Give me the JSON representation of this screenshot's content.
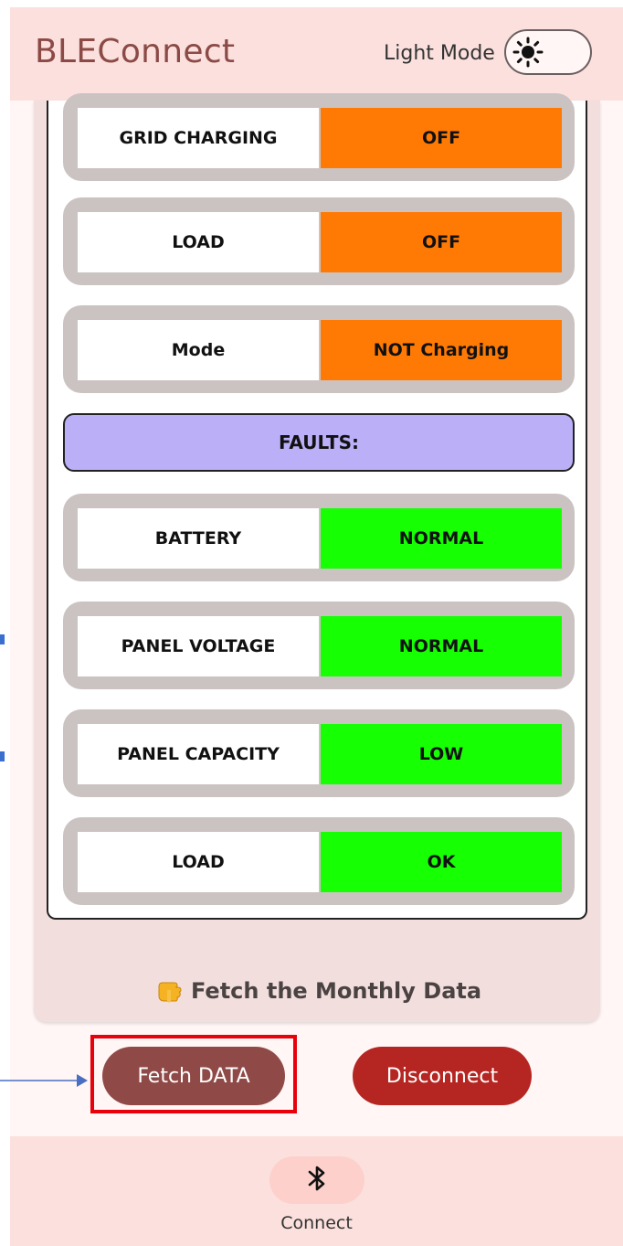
{
  "header": {
    "app_title": "BLEConnect",
    "mode_label": "Light Mode",
    "mode_icon": "sun-icon"
  },
  "status_rows": [
    {
      "label": "GRID CHARGING",
      "value": "OFF",
      "color": "#ff7a05"
    },
    {
      "label": "LOAD",
      "value": "OFF",
      "color": "#ff7a05"
    },
    {
      "label": "Mode",
      "value": "NOT Charging",
      "color": "#ff7a05"
    }
  ],
  "faults_header": "FAULTS:",
  "fault_rows": [
    {
      "label": "BATTERY",
      "value": "NORMAL",
      "color": "#16ff03"
    },
    {
      "label": "PANEL VOLTAGE",
      "value": "NORMAL",
      "color": "#16ff03"
    },
    {
      "label": "PANEL CAPACITY",
      "value": "LOW",
      "color": "#16ff03"
    },
    {
      "label": "LOAD",
      "value": "OK",
      "color": "#16ff03"
    }
  ],
  "fetch_note": "Fetch the Monthly Data",
  "buttons": {
    "fetch": "Fetch DATA",
    "disconnect": "Disconnect"
  },
  "bottom_nav": {
    "connect_label": "Connect",
    "connect_icon": "bluetooth-icon"
  },
  "colors": {
    "header_bg": "#fbe0dd",
    "title": "#8b4a46",
    "off_status": "#ff7a05",
    "ok_status": "#16ff03",
    "faults_bg": "#bbb0f8",
    "fetch_button": "#8f4a47",
    "disconnect_button": "#b52622",
    "highlight": "#e8000b"
  }
}
